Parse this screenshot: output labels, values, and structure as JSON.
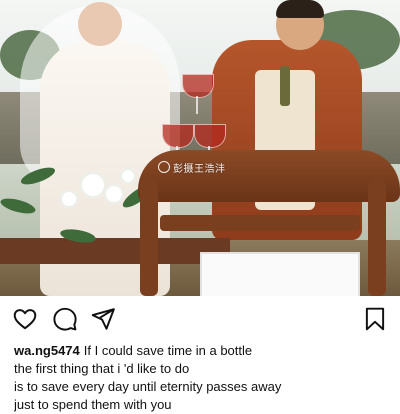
{
  "post": {
    "watermark": "彭摄王浩沣",
    "username": "wa.ng5474",
    "caption_lines": [
      "If I could save time in a bottle",
      "the first thing that i 'd like to do",
      "is to save every day until eternity passes away",
      "just to spend them with you"
    ]
  },
  "actions": {
    "like_icon": "heart-outline-icon",
    "comment_icon": "speech-bubble-icon",
    "share_icon": "paper-plane-icon",
    "save_icon": "bookmark-outline-icon"
  }
}
